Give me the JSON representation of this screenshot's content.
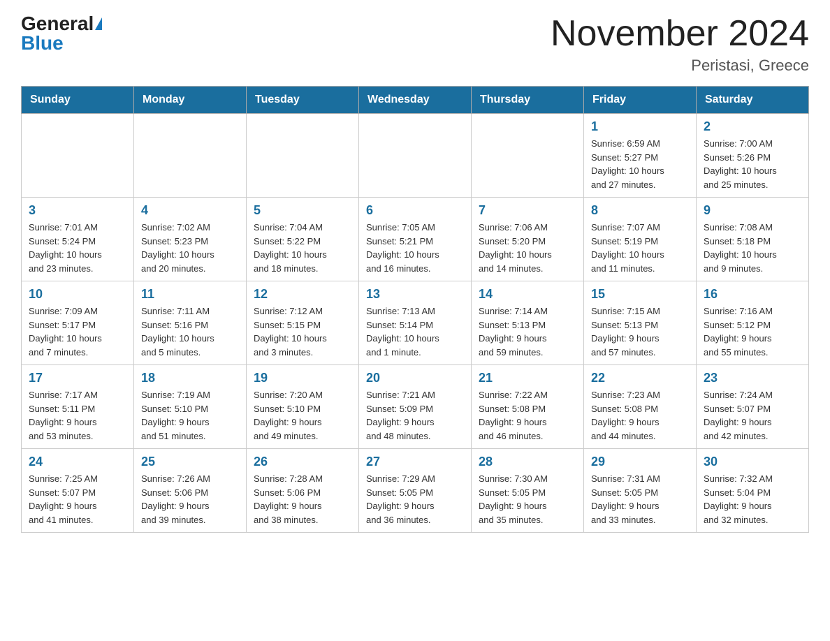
{
  "header": {
    "logo_general": "General",
    "logo_blue": "Blue",
    "month_title": "November 2024",
    "location": "Peristasi, Greece"
  },
  "weekdays": [
    "Sunday",
    "Monday",
    "Tuesday",
    "Wednesday",
    "Thursday",
    "Friday",
    "Saturday"
  ],
  "weeks": [
    [
      {
        "day": "",
        "info": ""
      },
      {
        "day": "",
        "info": ""
      },
      {
        "day": "",
        "info": ""
      },
      {
        "day": "",
        "info": ""
      },
      {
        "day": "",
        "info": ""
      },
      {
        "day": "1",
        "info": "Sunrise: 6:59 AM\nSunset: 5:27 PM\nDaylight: 10 hours\nand 27 minutes."
      },
      {
        "day": "2",
        "info": "Sunrise: 7:00 AM\nSunset: 5:26 PM\nDaylight: 10 hours\nand 25 minutes."
      }
    ],
    [
      {
        "day": "3",
        "info": "Sunrise: 7:01 AM\nSunset: 5:24 PM\nDaylight: 10 hours\nand 23 minutes."
      },
      {
        "day": "4",
        "info": "Sunrise: 7:02 AM\nSunset: 5:23 PM\nDaylight: 10 hours\nand 20 minutes."
      },
      {
        "day": "5",
        "info": "Sunrise: 7:04 AM\nSunset: 5:22 PM\nDaylight: 10 hours\nand 18 minutes."
      },
      {
        "day": "6",
        "info": "Sunrise: 7:05 AM\nSunset: 5:21 PM\nDaylight: 10 hours\nand 16 minutes."
      },
      {
        "day": "7",
        "info": "Sunrise: 7:06 AM\nSunset: 5:20 PM\nDaylight: 10 hours\nand 14 minutes."
      },
      {
        "day": "8",
        "info": "Sunrise: 7:07 AM\nSunset: 5:19 PM\nDaylight: 10 hours\nand 11 minutes."
      },
      {
        "day": "9",
        "info": "Sunrise: 7:08 AM\nSunset: 5:18 PM\nDaylight: 10 hours\nand 9 minutes."
      }
    ],
    [
      {
        "day": "10",
        "info": "Sunrise: 7:09 AM\nSunset: 5:17 PM\nDaylight: 10 hours\nand 7 minutes."
      },
      {
        "day": "11",
        "info": "Sunrise: 7:11 AM\nSunset: 5:16 PM\nDaylight: 10 hours\nand 5 minutes."
      },
      {
        "day": "12",
        "info": "Sunrise: 7:12 AM\nSunset: 5:15 PM\nDaylight: 10 hours\nand 3 minutes."
      },
      {
        "day": "13",
        "info": "Sunrise: 7:13 AM\nSunset: 5:14 PM\nDaylight: 10 hours\nand 1 minute."
      },
      {
        "day": "14",
        "info": "Sunrise: 7:14 AM\nSunset: 5:13 PM\nDaylight: 9 hours\nand 59 minutes."
      },
      {
        "day": "15",
        "info": "Sunrise: 7:15 AM\nSunset: 5:13 PM\nDaylight: 9 hours\nand 57 minutes."
      },
      {
        "day": "16",
        "info": "Sunrise: 7:16 AM\nSunset: 5:12 PM\nDaylight: 9 hours\nand 55 minutes."
      }
    ],
    [
      {
        "day": "17",
        "info": "Sunrise: 7:17 AM\nSunset: 5:11 PM\nDaylight: 9 hours\nand 53 minutes."
      },
      {
        "day": "18",
        "info": "Sunrise: 7:19 AM\nSunset: 5:10 PM\nDaylight: 9 hours\nand 51 minutes."
      },
      {
        "day": "19",
        "info": "Sunrise: 7:20 AM\nSunset: 5:10 PM\nDaylight: 9 hours\nand 49 minutes."
      },
      {
        "day": "20",
        "info": "Sunrise: 7:21 AM\nSunset: 5:09 PM\nDaylight: 9 hours\nand 48 minutes."
      },
      {
        "day": "21",
        "info": "Sunrise: 7:22 AM\nSunset: 5:08 PM\nDaylight: 9 hours\nand 46 minutes."
      },
      {
        "day": "22",
        "info": "Sunrise: 7:23 AM\nSunset: 5:08 PM\nDaylight: 9 hours\nand 44 minutes."
      },
      {
        "day": "23",
        "info": "Sunrise: 7:24 AM\nSunset: 5:07 PM\nDaylight: 9 hours\nand 42 minutes."
      }
    ],
    [
      {
        "day": "24",
        "info": "Sunrise: 7:25 AM\nSunset: 5:07 PM\nDaylight: 9 hours\nand 41 minutes."
      },
      {
        "day": "25",
        "info": "Sunrise: 7:26 AM\nSunset: 5:06 PM\nDaylight: 9 hours\nand 39 minutes."
      },
      {
        "day": "26",
        "info": "Sunrise: 7:28 AM\nSunset: 5:06 PM\nDaylight: 9 hours\nand 38 minutes."
      },
      {
        "day": "27",
        "info": "Sunrise: 7:29 AM\nSunset: 5:05 PM\nDaylight: 9 hours\nand 36 minutes."
      },
      {
        "day": "28",
        "info": "Sunrise: 7:30 AM\nSunset: 5:05 PM\nDaylight: 9 hours\nand 35 minutes."
      },
      {
        "day": "29",
        "info": "Sunrise: 7:31 AM\nSunset: 5:05 PM\nDaylight: 9 hours\nand 33 minutes."
      },
      {
        "day": "30",
        "info": "Sunrise: 7:32 AM\nSunset: 5:04 PM\nDaylight: 9 hours\nand 32 minutes."
      }
    ]
  ]
}
